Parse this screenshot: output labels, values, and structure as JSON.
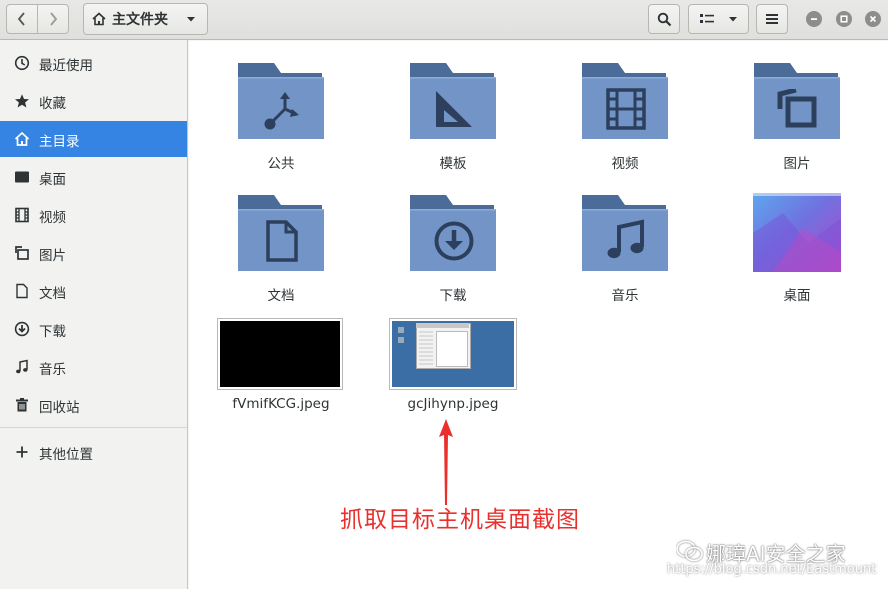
{
  "header": {
    "path_label": "主文件夹",
    "icons": [
      "back-icon",
      "forward-icon",
      "home-icon",
      "dropdown-icon",
      "search-icon",
      "list-view-icon",
      "menu-icon",
      "minimize-icon",
      "maximize-icon",
      "close-icon"
    ]
  },
  "sidebar": {
    "items": [
      {
        "label": "最近使用",
        "icon": "clock-icon"
      },
      {
        "label": "收藏",
        "icon": "star-icon"
      },
      {
        "label": "主目录",
        "icon": "home-icon",
        "active": true
      },
      {
        "label": "桌面",
        "icon": "desktop-icon"
      },
      {
        "label": "视频",
        "icon": "film-icon"
      },
      {
        "label": "图片",
        "icon": "picture-icon"
      },
      {
        "label": "文档",
        "icon": "document-icon"
      },
      {
        "label": "下载",
        "icon": "download-icon"
      },
      {
        "label": "音乐",
        "icon": "music-icon"
      },
      {
        "label": "回收站",
        "icon": "trash-icon"
      }
    ],
    "other_label": "其他位置"
  },
  "files": [
    {
      "label": "公共",
      "type": "folder",
      "icon": "share-icon"
    },
    {
      "label": "模板",
      "type": "folder",
      "icon": "template-icon"
    },
    {
      "label": "视频",
      "type": "folder",
      "icon": "film-icon"
    },
    {
      "label": "图片",
      "type": "folder",
      "icon": "picture-icon"
    },
    {
      "label": "文档",
      "type": "folder",
      "icon": "document-icon"
    },
    {
      "label": "下载",
      "type": "folder",
      "icon": "download-icon"
    },
    {
      "label": "音乐",
      "type": "folder",
      "icon": "music-icon"
    },
    {
      "label": "桌面",
      "type": "folder",
      "icon": "desktop-thumbnail"
    },
    {
      "label": "fVmifKCG.jpeg",
      "type": "image"
    },
    {
      "label": "gcJihynp.jpeg",
      "type": "image"
    }
  ],
  "annotation": "抓取目标主机桌面截图",
  "watermark": {
    "brand": "娜璋AI安全之家",
    "url": "https://blog.csdn.net/Eastmount"
  },
  "colors": {
    "accent": "#3584e4",
    "folder": "#6d8ec0",
    "annotation": "#e9302d"
  }
}
